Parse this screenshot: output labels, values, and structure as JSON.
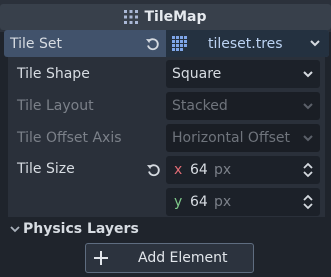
{
  "header": {
    "title": "TileMap",
    "icon": "tilemap-grid-icon"
  },
  "tile_set": {
    "label": "Tile Set",
    "value": "tileset.tres",
    "icon": "tileset-grid-icon"
  },
  "tile_shape": {
    "label": "Tile Shape",
    "value": "Square"
  },
  "tile_layout": {
    "label": "Tile Layout",
    "value": "Stacked"
  },
  "tile_offset_axis": {
    "label": "Tile Offset Axis",
    "value": "Horizontal Offset"
  },
  "tile_size": {
    "label": "Tile Size",
    "x_axis": "x",
    "x_value": "64",
    "x_unit": "px",
    "y_axis": "y",
    "y_value": "64",
    "y_unit": "px"
  },
  "physics_layers": {
    "label": "Physics Layers"
  },
  "add_element": {
    "label": "Add Element"
  },
  "colors": {
    "accent_row": "#41526b",
    "x_axis": "#e06c75",
    "y_axis": "#7fc98a",
    "panel": "#2a303a",
    "background": "#1f242c"
  }
}
